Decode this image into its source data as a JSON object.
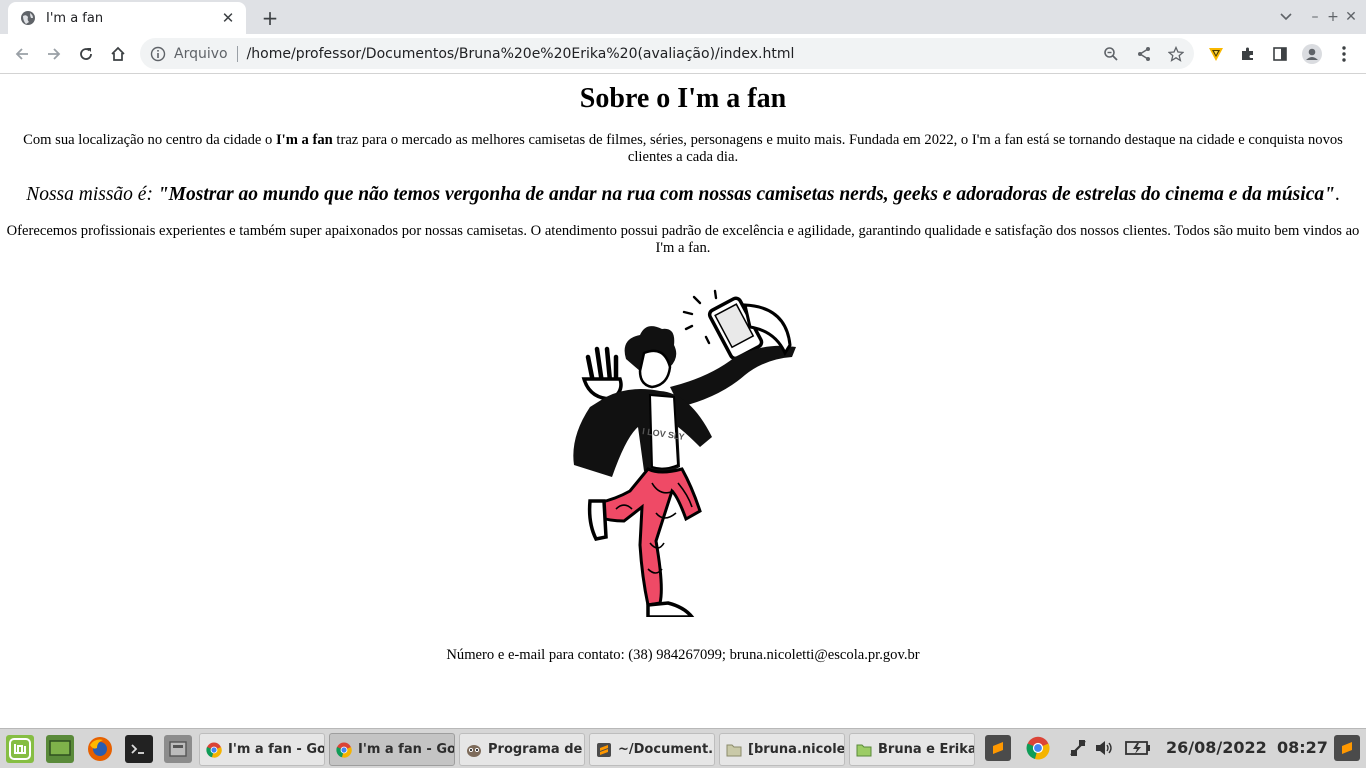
{
  "browser": {
    "tab_title": "I'm a fan",
    "new_tab": "+",
    "url_scheme": "Arquivo",
    "url": "/home/professor/Documentos/Bruna%20e%20Erika%20(avaliação)/index.html"
  },
  "page": {
    "heading": "Sobre o I'm a fan",
    "intro_before": "Com sua localização no centro da cidade o ",
    "intro_brand": "I'm a fan",
    "intro_after": " traz para o mercado as melhores camisetas de filmes, séries, personagens e muito mais. Fundada em 2022, o I'm a fan está se tornando destaque na cidade e conquista novos clientes a cada dia.",
    "mission_label": "Nossa missão é: ",
    "mission_quote": "\"Mostrar ao mundo que não temos vergonha de andar na rua com nossas camisetas nerds, geeks e adoradoras de estrelas do cinema e da música\"",
    "mission_end": ".",
    "service_text": "Oferecemos profissionais experientes e também super apaixonados por nossas camisetas. O atendimento possui padrão de excelência e agilidade, garantindo qualidade e satisfação dos nossos clientes. Todos são muito bem vindos ao I'm a fan.",
    "shirt_text": "I LOV SLY",
    "contact": "Número e e-mail para contato: (38) 984267099; bruna.nicoletti@escola.pr.gov.br"
  },
  "taskbar": {
    "tasks": [
      {
        "label": "I'm a fan - Go...",
        "icon": "chrome-icon"
      },
      {
        "label": "I'm a fan - Go...",
        "icon": "chrome-icon"
      },
      {
        "label": "Programa de ...",
        "icon": "gimp-icon"
      },
      {
        "label": "~/Document...",
        "icon": "sublime-icon"
      },
      {
        "label": "[bruna.nicole...",
        "icon": "folder-icon"
      },
      {
        "label": "Bruna e Erika...",
        "icon": "folder-icon"
      }
    ],
    "date": "26/08/2022",
    "time": "08:27"
  },
  "colors": {
    "pants": "#ef4a66",
    "taskbar": "#d6d6d6",
    "mint": "#86be43"
  }
}
